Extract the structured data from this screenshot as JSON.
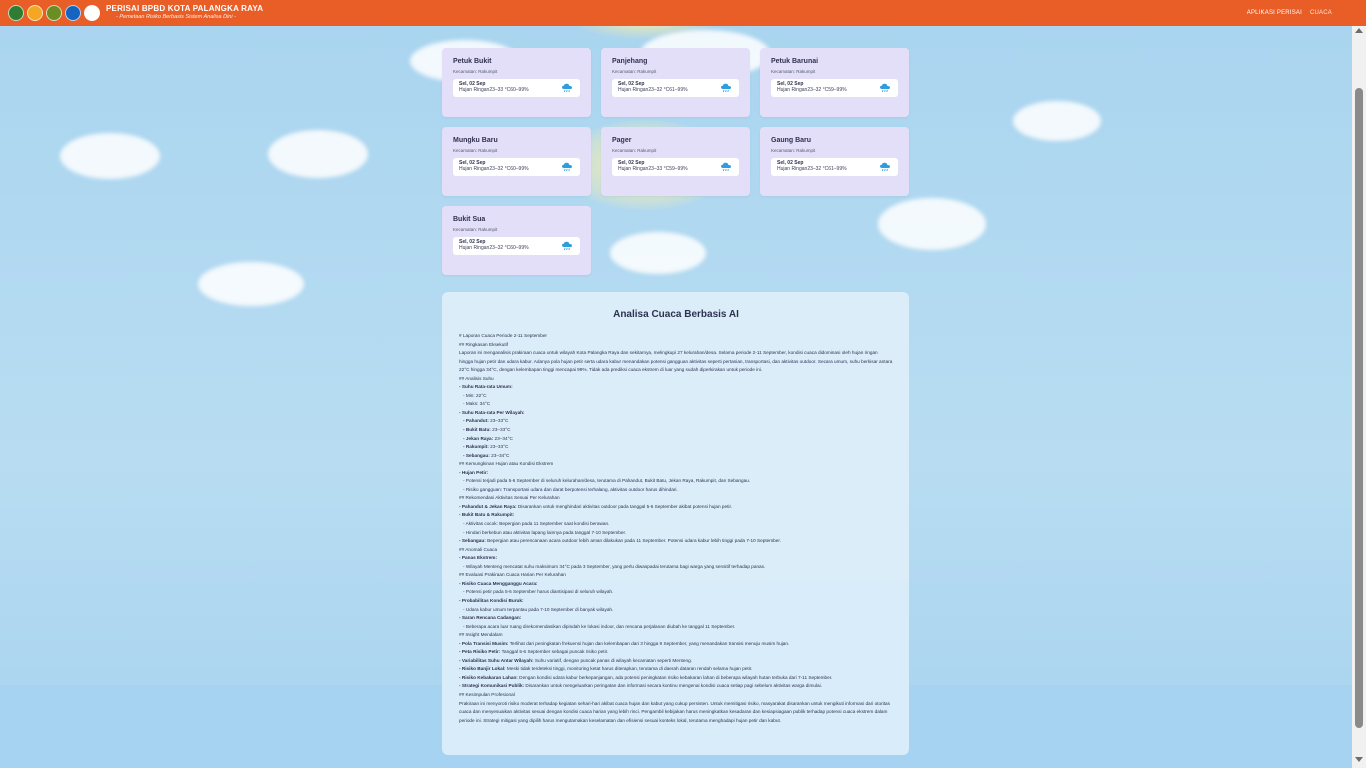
{
  "header": {
    "title": "PERISAI BPBD KOTA PALANGKA RAYA",
    "subtitle": "- Pemetaan Risiko Berbasis Sistem Analisa Dini -",
    "nav": [
      "APLIKASI PERISAI",
      "CUACA"
    ],
    "logos": [
      "kota-palangka-raya-logo",
      "bpbd-logo",
      "garuda-logo",
      "bmkg-logo",
      "perisai-logo"
    ]
  },
  "colors": {
    "header_bg": "#e95d26",
    "card_bg": "#e3dff8",
    "rain_icon": "#2d9de0"
  },
  "locations": [
    {
      "name": "Petuk Bukit",
      "district": "Kecamatan: Rakumpit",
      "date": "Sel, 02 Sep",
      "condition": "Hujan Ringan",
      "temp": "23–33 °C",
      "humidity": "60–99%",
      "icon": "rain-cloud-icon"
    },
    {
      "name": "Panjehang",
      "district": "Kecamatan: Rakumpit",
      "date": "Sel, 02 Sep",
      "condition": "Hujan Ringan",
      "temp": "23–32 °C",
      "humidity": "61–99%",
      "icon": "rain-cloud-icon"
    },
    {
      "name": "Petuk Barunai",
      "district": "Kecamatan: Rakumpit",
      "date": "Sel, 02 Sep",
      "condition": "Hujan Ringan",
      "temp": "23–32 °C",
      "humidity": "59–99%",
      "icon": "rain-cloud-icon"
    },
    {
      "name": "Mungku Baru",
      "district": "Kecamatan: Rakumpit",
      "date": "Sel, 02 Sep",
      "condition": "Hujan Ringan",
      "temp": "23–32 °C",
      "humidity": "60–99%",
      "icon": "rain-cloud-icon"
    },
    {
      "name": "Pager",
      "district": "Kecamatan: Rakumpit",
      "date": "Sel, 02 Sep",
      "condition": "Hujan Ringan",
      "temp": "23–33 °C",
      "humidity": "59–99%",
      "icon": "rain-cloud-icon"
    },
    {
      "name": "Gaung Baru",
      "district": "Kecamatan: Rakumpit",
      "date": "Sel, 02 Sep",
      "condition": "Hujan Ringan",
      "temp": "23–32 °C",
      "humidity": "61–99%",
      "icon": "rain-cloud-icon"
    },
    {
      "name": "Bukit Sua",
      "district": "Kecamatan: Rakumpit",
      "date": "Sel, 02 Sep",
      "condition": "Hujan Ringan",
      "temp": "23–32 °C",
      "humidity": "60–99%",
      "icon": "rain-cloud-icon"
    }
  ],
  "analysis": {
    "title": "Analisa Cuaca Berbasis AI",
    "lines": [
      {
        "t": "# Laporan Cuaca Periode 2-11 September"
      },
      {
        "t": "## Ringkasan Eksekutif"
      },
      {
        "t": "Laporan ini menganalisis prakiraan cuaca untuk wilayah Kota Palangka Raya dan sekitarnya, melingkupi 27 kelurahan/desa. Selama periode 2-11 September, kondisi cuaca didominasi oleh hujan ringan hingga hujan petir dan udara kabur. Adanya pola hujan petir serta udara kabur menandakan potensi gangguan aktivitas seperti pertanian, transportasi, dan aktivitas outdoor. Secara umum, suhu berkisar antara 22°C hingga 34°C, dengan kelembapan tinggi mencapai 99%. Tidak ada prediksi cuaca ekstrem di luar yang sudah diperkirakan untuk periode ini.",
        "wrap": true
      },
      {
        "t": "## Analisis Suhu"
      },
      {
        "b": "- Suhu Rata-rata Umum:",
        "t": ""
      },
      {
        "t": "  - Min: 22°C",
        "i": true
      },
      {
        "t": "  - Maks: 34°C",
        "i": true
      },
      {
        "b": "- Suhu Rata-rata Per Wilayah:",
        "t": ""
      },
      {
        "b": "  - Pahandut:",
        "t": " 23–33°C",
        "i": true
      },
      {
        "b": "  - Bukit Batu:",
        "t": " 23–33°C",
        "i": true
      },
      {
        "b": "  - Jekan Raya:",
        "t": " 23–34°C",
        "i": true
      },
      {
        "b": "  - Rakumpit:",
        "t": " 23–33°C",
        "i": true
      },
      {
        "b": "  - Sebangau:",
        "t": " 23–34°C",
        "i": true
      },
      {
        "t": "## Kemungkinan Hujan atau Kondisi Ekstrem"
      },
      {
        "b": "- Hujan Petir:",
        "t": ""
      },
      {
        "t": "  - Potensi terjadi pada 5-6 September di seluruh kelurahan/desa, terutama di Pahandut, Bukit Batu, Jekan Raya, Rakumpit, dan Sebangau.",
        "i": true
      },
      {
        "t": "  - Risiko gangguan: Transportasi udara dan darat berpotensi terhalang, aktivitas outdoor harus dihindari.",
        "i": true
      },
      {
        "t": "## Rekomendasi Aktivitas Sesuai Per Kelurahan"
      },
      {
        "b": "- Pahandut & Jekan Raya:",
        "t": " Disarankan untuk menghindari aktivitas outdoor pada tanggal 5-6 September akibat potensi hujan petir."
      },
      {
        "t": " "
      },
      {
        "b": "- Bukit Batu & Rakumpit:",
        "t": ""
      },
      {
        "t": "  - Aktivitas cocok: Bepergian pada 11 September saat kondisi berawan.",
        "i": true
      },
      {
        "t": "  - Hindari berkebun atau aktivitas lapang lainnya pada tanggal 7-10 September.",
        "i": true
      },
      {
        "b": "- Sebangau:",
        "t": " Bepergian atau perencanaan acara outdoor lebih aman dilakukan pada 11 September. Potensi udara kabur lebih tinggi pada 7-10 September."
      },
      {
        "t": "## Anomali Cuaca"
      },
      {
        "b": "- Panas Ekstrem:",
        "t": ""
      },
      {
        "t": "  - Wilayah Menteng mencatat suhu maksimum 34°C pada 3 September, yang perlu diwaspadai terutama bagi warga yang sensitif terhadap panas.",
        "i": true
      },
      {
        "t": "## Evaluasi Prakiraan Cuaca Harian Per Kelurahan"
      },
      {
        "b": "- Risiko Cuaca Mengganggu Acara:",
        "t": ""
      },
      {
        "t": "  - Potensi petir pada 5-6 September harus diantisipasi di seluruh wilayah.",
        "i": true
      },
      {
        "b": "- Probabilitas Kondisi Buruk:",
        "t": ""
      },
      {
        "t": "  - Udara kabur umum terpantau pada 7-10 September di banyak wilayah.",
        "i": true
      },
      {
        "b": "- Saran Rencana Cadangan:",
        "t": ""
      },
      {
        "t": "  - Beberapa acara luar ruang direkomendasikan dipindah ke lokasi indoor, dan rencana perjalanan diubah ke tanggal 11 September.",
        "i": true
      },
      {
        "t": "## Insight Mendalam"
      },
      {
        "b": "- Pola Transisi Musim:",
        "t": " Terlihat dari peningkatan frekuensi hujan dan kelembapan dari 3 hingga 9 September, yang menandakan transisi menuju musim hujan."
      },
      {
        "b": "- Peta Risiko Petir:",
        "t": " Tanggal 5-6 September sebagai puncak risiko petir."
      },
      {
        "b": "- Variabilitas Suhu Antar Wilayah:",
        "t": " Suhu variatif, dengan puncak panas di wilayah kecamatan seperti Menteng."
      },
      {
        "b": "- Risiko Banjir Lokal:",
        "t": " Meski tidak terdeteksi tinggi, monitoring ketat harus diterapkan, terutama di daerah dataran rendah selama hujan petir."
      },
      {
        "b": "- Risiko Kebakaran Lahan:",
        "t": " Dengan kondisi udara kabur berkepanjangan, ada potensi peningkatan risiko kebakaran lahan di beberapa wilayah hutan terbuka dari 7-11 September."
      },
      {
        "b": "- Strategi Komunikasi Publik:",
        "t": " Disarankan untuk mengeluarkan peringatan dan informasi secara kontinu mengenai kondisi cuaca setiap pagi sebelum aktivitas warga dimulai."
      },
      {
        "t": "## Kesimpulan Profesional"
      },
      {
        "t": "Prakiraan ini menyoroti risiko moderat terhadap kegiatan sehari-hari akibat cuaca hujan dan kabut yang cukup persisten. Untuk memitigasi risiko, masyarakat disarankan untuk mengikuti informasi dari otoritas cuaca dan menyesuaikan aktivitas sesuai dengan kondisi cuaca harian yang lebih rinci. Pengambil kebijakan harus meningkatkan kesadaran dan kesiapsiagaan publik terhadap potensi cuaca ekstrem dalam periode ini. Strategi mitigasi yang dipilih harus mengutamakan keselamatan dan efisiensi sesuai konteks lokal, terutama menghadapi hujan petir dan kabut.",
        "wrap": true
      }
    ]
  }
}
